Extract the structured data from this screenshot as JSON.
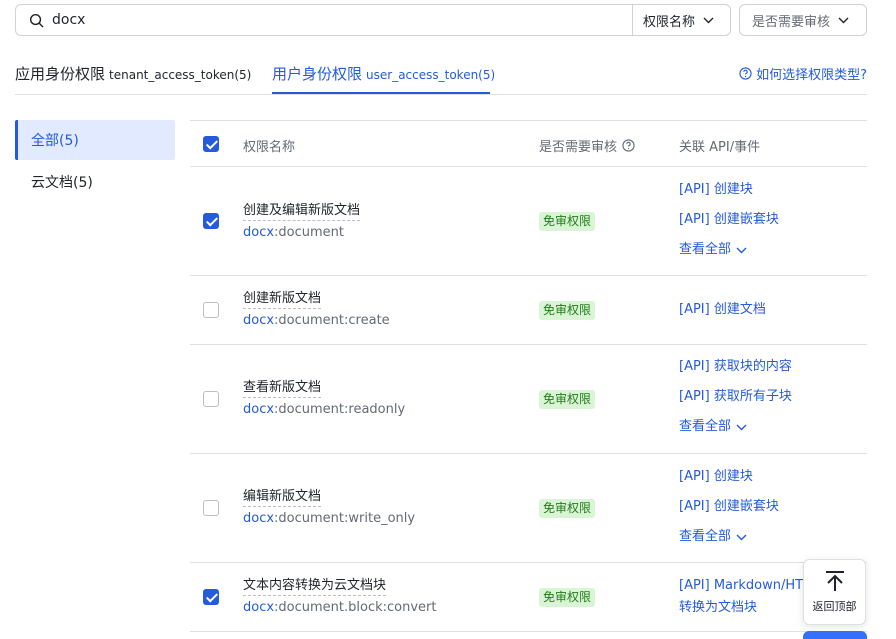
{
  "search": {
    "value": "docx"
  },
  "filters": {
    "name": "权限名称",
    "review": "是否需要审核"
  },
  "tabs": {
    "app": {
      "label": "应用身份权限",
      "token": "tenant_access_token(5)"
    },
    "user": {
      "label": "用户身份权限",
      "token": "user_access_token(5)"
    }
  },
  "help": {
    "label": "如何选择权限类型?"
  },
  "sidebar": {
    "items": [
      {
        "label": "全部(5)"
      },
      {
        "label": "云文档(5)"
      }
    ]
  },
  "table": {
    "headers": {
      "name": "权限名称",
      "review": "是否需要审核",
      "api": "关联 API/事件"
    },
    "rows": [
      {
        "name": "创建及编辑新版文档",
        "code_prefix": "docx",
        "code_rest": ":document",
        "badge": "免审权限",
        "checked": true,
        "apis": [
          "[API] 创建块",
          "[API] 创建嵌套块"
        ],
        "more": "查看全部"
      },
      {
        "name": "创建新版文档",
        "code_prefix": "docx",
        "code_rest": ":document:create",
        "badge": "免审权限",
        "checked": false,
        "apis": [
          "[API] 创建文档"
        ]
      },
      {
        "name": "查看新版文档",
        "code_prefix": "docx",
        "code_rest": ":document:readonly",
        "badge": "免审权限",
        "checked": false,
        "apis": [
          "[API] 获取块的内容",
          "[API] 获取所有子块"
        ],
        "more": "查看全部"
      },
      {
        "name": "编辑新版文档",
        "code_prefix": "docx",
        "code_rest": ":document:write_only",
        "badge": "免审权限",
        "checked": false,
        "apis": [
          "[API] 创建块",
          "[API] 创建嵌套块"
        ],
        "more": "查看全部"
      },
      {
        "name": "文本内容转换为云文档块",
        "code_prefix": "docx",
        "code_rest": ":document.block:convert",
        "badge": "免审权限",
        "checked": true,
        "apis": [
          "[API] Markdown/HT",
          "转换为文档块"
        ]
      }
    ]
  },
  "back_to_top": {
    "label": "返回顶部"
  },
  "colors": {
    "accent": "#245bdb",
    "badge_bg": "#d9f5d6",
    "badge_text": "#237b19"
  }
}
